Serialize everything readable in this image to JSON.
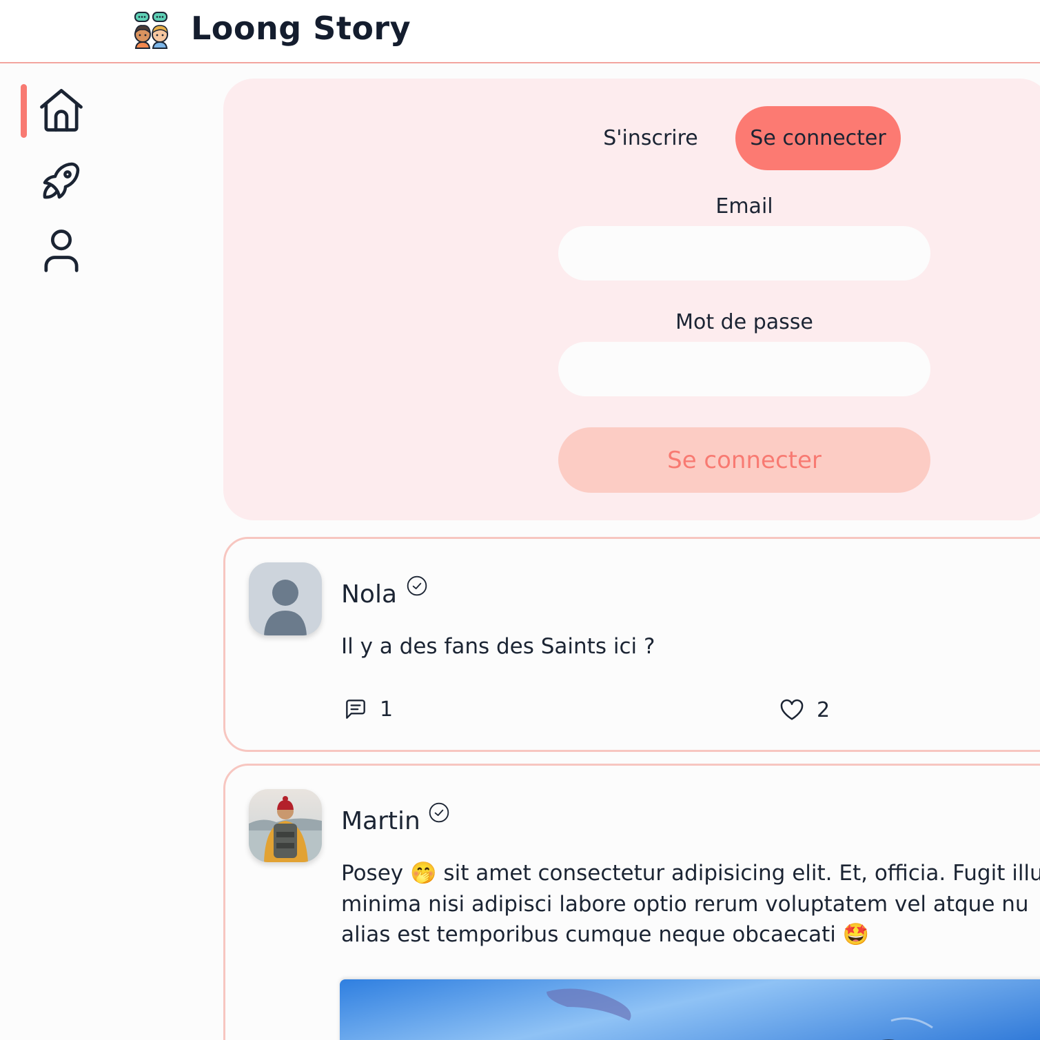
{
  "header": {
    "app_title": "Loong Story"
  },
  "sidebar": {
    "items": [
      {
        "name": "home",
        "icon": "home-icon",
        "active": true
      },
      {
        "name": "explore",
        "icon": "rocket-icon",
        "active": false
      },
      {
        "name": "profile",
        "icon": "user-icon",
        "active": false
      }
    ]
  },
  "auth": {
    "tab_register": "S'inscrire",
    "tab_login": "Se connecter",
    "email_label": "Email",
    "email_value": "",
    "password_label": "Mot de passe",
    "password_value": "",
    "submit_label": "Se connecter"
  },
  "posts": [
    {
      "author": "Nola",
      "verified": true,
      "text": "Il y a des fans des Saints ici ?",
      "comments": "1",
      "likes": "2"
    },
    {
      "author": "Martin",
      "verified": true,
      "lines": [
        "Posey 🤭 sit amet consectetur adipisicing elit. Et, officia. Fugit illu",
        "minima nisi adipisci labore optio rerum voluptatem vel atque nu",
        "alias est temporibus cumque neque obcaecati 🤩"
      ]
    }
  ],
  "colors": {
    "accent": "#fc7a72",
    "card_bg": "#fdecee",
    "border": "#f7c6c0"
  }
}
